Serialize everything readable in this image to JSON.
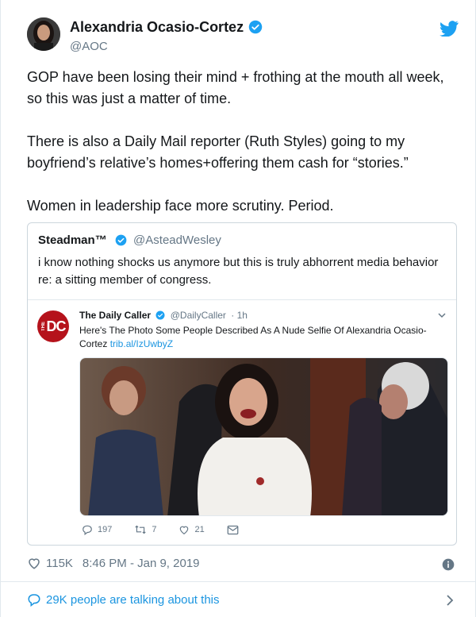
{
  "author": {
    "name": "Alexandria Ocasio-Cortez",
    "handle": "@AOC",
    "verified": true
  },
  "tweet": {
    "paragraphs": [
      "GOP have been losing their mind + frothing at the mouth all week, so this was just a matter of time.",
      "There is also a Daily Mail reporter (Ruth Styles) going to my boyfriend’s relative’s homes+offering them cash for “stories.”",
      "Women in leadership face more scrutiny. Period."
    ],
    "likes": "115K",
    "timestamp": "8:46 PM - Jan 9, 2019",
    "talking": "29K people are talking about this"
  },
  "quote": {
    "name": "Steadman™",
    "handle": "@AsteadWesley",
    "text": "i know nothing shocks us anymore but this is truly abhorrent media behavior re: a sitting member of congress."
  },
  "embedded": {
    "logo_text": "DC",
    "logo_prefix": "THE",
    "name": "The Daily Caller",
    "handle": "@DailyCaller",
    "time": "· 1h",
    "text": "Here's The Photo Some People Described As A Nude Selfie Of Alexandria Ocasio-Cortez",
    "link": "trib.al/IzUwbyZ",
    "replies": "197",
    "retweets": "7",
    "likes": "21"
  },
  "colors": {
    "brand_blue": "#1da1f2",
    "link_blue": "#1b95e0",
    "daily_caller_red": "#b5121b",
    "muted": "#657786"
  },
  "icons": [
    "avatar",
    "verified-badge-icon",
    "twitter-bird-icon",
    "chevron-down-icon",
    "reply-icon",
    "retweet-icon",
    "heart-icon",
    "mail-icon",
    "info-icon",
    "chat-bubble-icon",
    "chevron-right-icon"
  ]
}
